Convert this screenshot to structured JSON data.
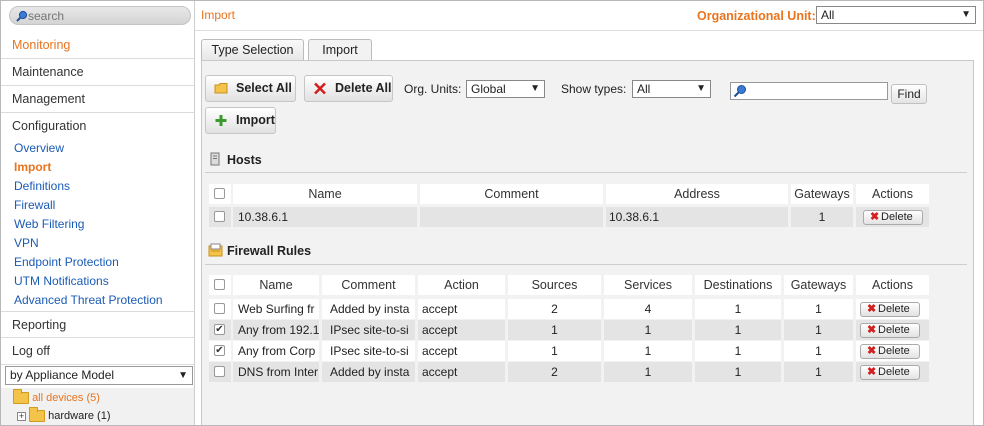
{
  "search": {
    "placeholder": "search"
  },
  "sidebar": {
    "main_items": [
      {
        "label": "Monitoring"
      },
      {
        "label": "Maintenance"
      },
      {
        "label": "Management"
      },
      {
        "label": "Configuration"
      },
      {
        "label": "Reporting"
      },
      {
        "label": "Log off"
      }
    ],
    "sub_items": [
      {
        "label": "Overview"
      },
      {
        "label": "Import"
      },
      {
        "label": "Definitions"
      },
      {
        "label": "Firewall"
      },
      {
        "label": "Web Filtering"
      },
      {
        "label": "VPN"
      },
      {
        "label": "Endpoint Protection"
      },
      {
        "label": "UTM Notifications"
      },
      {
        "label": "Advanced Threat Protection"
      }
    ],
    "model_select": "by Appliance Model",
    "tree": {
      "all_devices": "all devices (5)",
      "hardware": "hardware (1)"
    }
  },
  "topbar": {
    "breadcrumb": "Import",
    "ou_label": "Organizational Unit:",
    "ou_value": "All"
  },
  "tabs": [
    {
      "label": "Type Selection"
    },
    {
      "label": "Import"
    }
  ],
  "toolbar": {
    "select_all": "Select All",
    "delete_all": "Delete All",
    "import": "Import",
    "org_units_label": "Org. Units:",
    "org_units_value": "Global",
    "show_types_label": "Show types:",
    "show_types_value": "All",
    "find_label": "Find"
  },
  "hosts": {
    "title": "Hosts",
    "headers": [
      "Name",
      "Comment",
      "Address",
      "Gateways",
      "Actions"
    ],
    "rows": [
      {
        "name": "10.38.6.1",
        "comment": "",
        "address": "10.38.6.1",
        "gateways": "1",
        "checked": false
      }
    ]
  },
  "firewall": {
    "title": "Firewall Rules",
    "headers": [
      "Name",
      "Comment",
      "Action",
      "Sources",
      "Services",
      "Destinations",
      "Gateways",
      "Actions"
    ],
    "rows": [
      {
        "name": "Web Surfing fr",
        "comment": "Added by insta",
        "action": "accept",
        "sources": "2",
        "services": "4",
        "destinations": "1",
        "gateways": "1",
        "checked": false
      },
      {
        "name": "Any from 192.1",
        "comment": "IPsec site-to-si",
        "action": "accept",
        "sources": "1",
        "services": "1",
        "destinations": "1",
        "gateways": "1",
        "checked": true
      },
      {
        "name": "Any from Corp",
        "comment": "IPsec site-to-si",
        "action": "accept",
        "sources": "1",
        "services": "1",
        "destinations": "1",
        "gateways": "1",
        "checked": true
      },
      {
        "name": "DNS from Inter",
        "comment": "Added by insta",
        "action": "accept",
        "sources": "2",
        "services": "1",
        "destinations": "1",
        "gateways": "1",
        "checked": false
      }
    ]
  },
  "delete_label": "Delete",
  "colors": {
    "accent": "#e8741e",
    "link": "#1a5bb5",
    "panel": "#f2f2f2"
  }
}
